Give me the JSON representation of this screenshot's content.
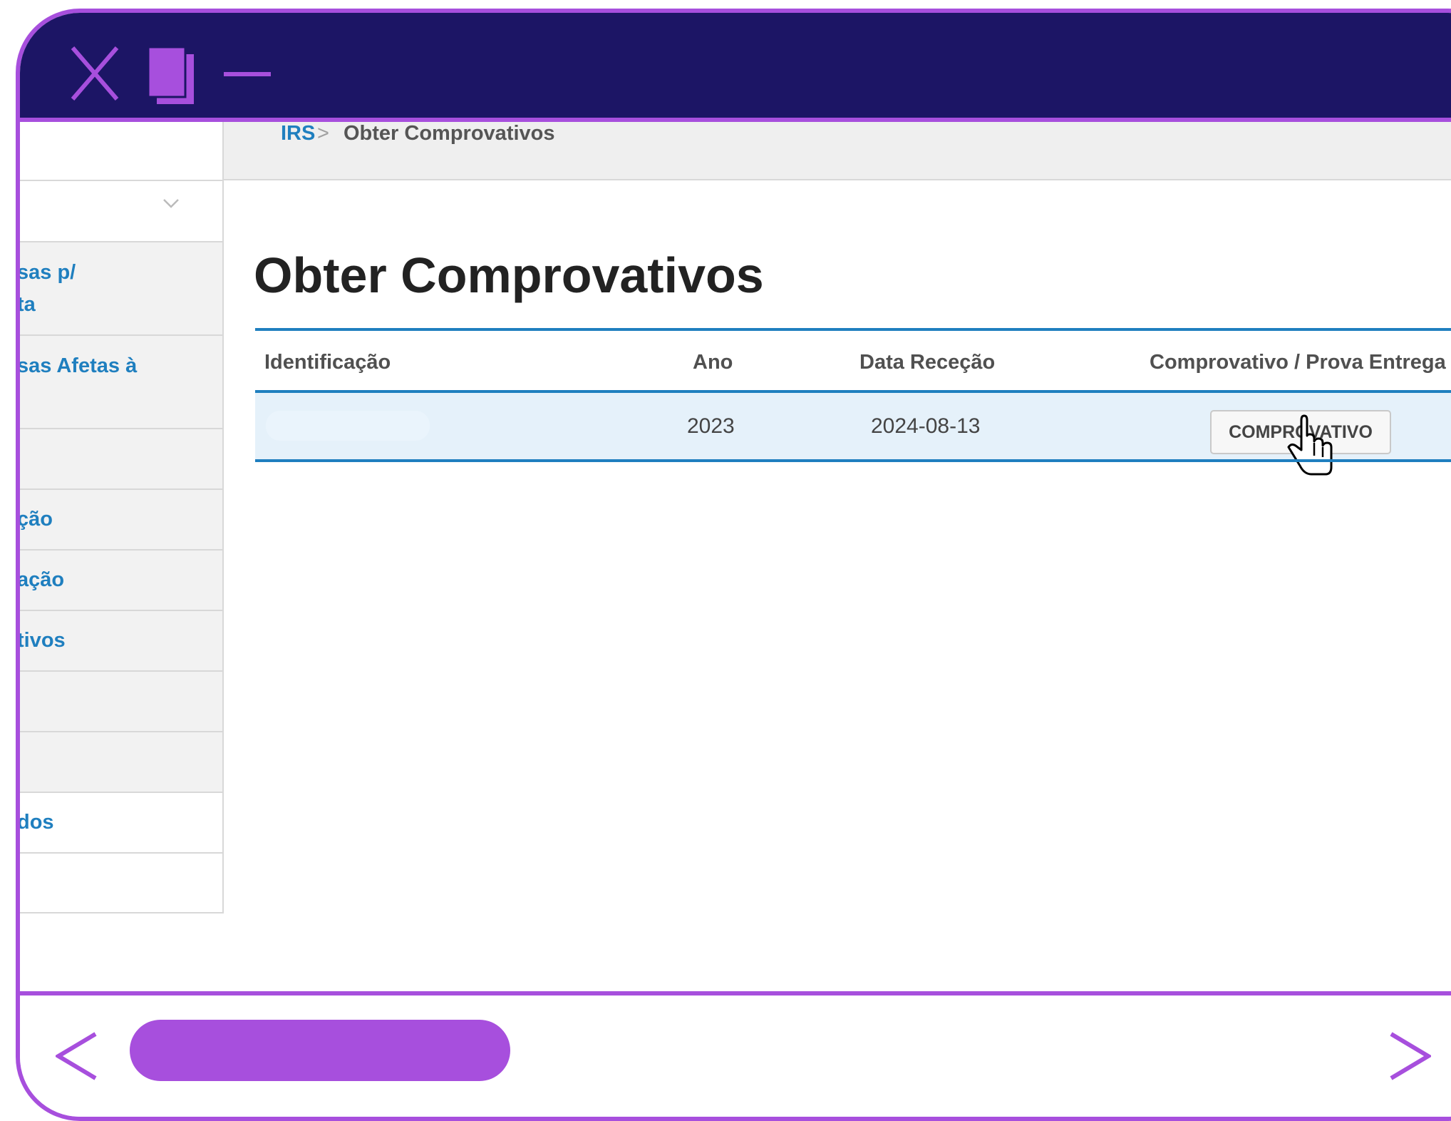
{
  "breadcrumb": {
    "root": "IRS",
    "separator": ">",
    "current": "Obter Comprovativos"
  },
  "page": {
    "title": "Obter Comprovativos"
  },
  "sidebar": {
    "items": [
      {
        "label": ""
      },
      {
        "line1": "sas p/",
        "line2": "ta"
      },
      {
        "line1": "sas Afetas à",
        "line2": ""
      },
      {
        "label": ""
      },
      {
        "label": "ção"
      },
      {
        "label": "ação"
      },
      {
        "label": "tivos"
      },
      {
        "label": ""
      },
      {
        "label": ""
      },
      {
        "label": "dos"
      },
      {
        "label": ""
      }
    ]
  },
  "table": {
    "headers": [
      "Identificação",
      "Ano",
      "Data Receção",
      "Comprovativo / Prova Entrega"
    ],
    "rows": [
      {
        "identificacao": "",
        "ano": "2023",
        "data_rececao": "2024-08-13",
        "button_label": "COMPROVATIVO"
      }
    ]
  },
  "window": {
    "controls": [
      "close-icon",
      "maximize-icon",
      "minimize-icon"
    ],
    "nav": [
      "arrow-left-icon",
      "arrow-right-icon"
    ]
  },
  "colors": {
    "frame": "#a74fdd",
    "titlebar": "#1c1565",
    "link": "#1f7fbf",
    "row_highlight": "#e5f1fa"
  }
}
